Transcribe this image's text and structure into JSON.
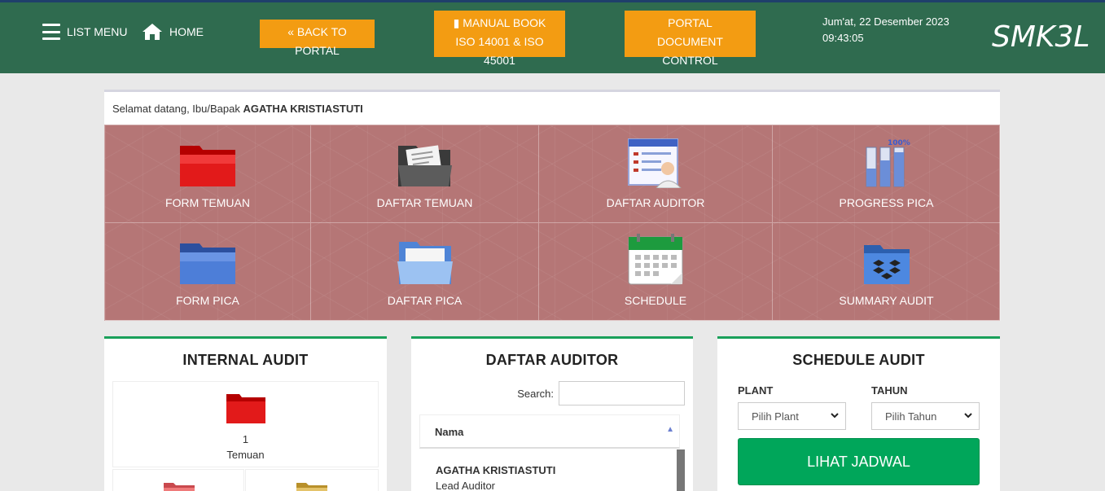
{
  "header": {
    "list_menu": "LIST MENU",
    "home": "HOME",
    "back_to_portal": "« BACK TO PORTAL",
    "manual_book_line1": "MANUAL BOOK",
    "manual_book_line2": "ISO 14001 & ISO 45001",
    "portal_line1": "PORTAL",
    "portal_line2": "DOCUMENT CONTROL",
    "date": "Jum'at, 22 Desember 2023",
    "time": "09:43:05",
    "brand": "SMK3L",
    "colors": {
      "bar": "#2f6b4f",
      "button": "#f39c12"
    }
  },
  "welcome": {
    "prefix": "Selamat datang, Ibu/Bapak",
    "name": "AGATHA KRISTIASTUTI"
  },
  "tiles": [
    {
      "label": "FORM TEMUAN",
      "icon": "red-folder-icon"
    },
    {
      "label": "DAFTAR TEMUAN",
      "icon": "document-folder-icon"
    },
    {
      "label": "DAFTAR AUDITOR",
      "icon": "auditor-list-icon"
    },
    {
      "label": "PROGRESS PICA",
      "icon": "progress-bars-icon"
    },
    {
      "label": "FORM PICA",
      "icon": "blue-folder-icon"
    },
    {
      "label": "DAFTAR PICA",
      "icon": "open-blue-folder-icon"
    },
    {
      "label": "SCHEDULE",
      "icon": "calendar-icon"
    },
    {
      "label": "SUMMARY AUDIT",
      "icon": "dropbox-folder-icon"
    }
  ],
  "internal_audit": {
    "title": "INTERNAL AUDIT",
    "count": "1",
    "label": "Temuan"
  },
  "daftar_auditor": {
    "title": "DAFTAR AUDITOR",
    "search_label": "Search:",
    "column": "Nama",
    "rows": [
      {
        "name": "AGATHA KRISTIASTUTI",
        "role": "Lead Auditor"
      }
    ]
  },
  "schedule_audit": {
    "title": "SCHEDULE AUDIT",
    "plant_label": "PLANT",
    "tahun_label": "TAHUN",
    "plant_value": "Pilih Plant",
    "tahun_value": "Pilih Tahun",
    "button": "LIHAT JADWAL"
  }
}
